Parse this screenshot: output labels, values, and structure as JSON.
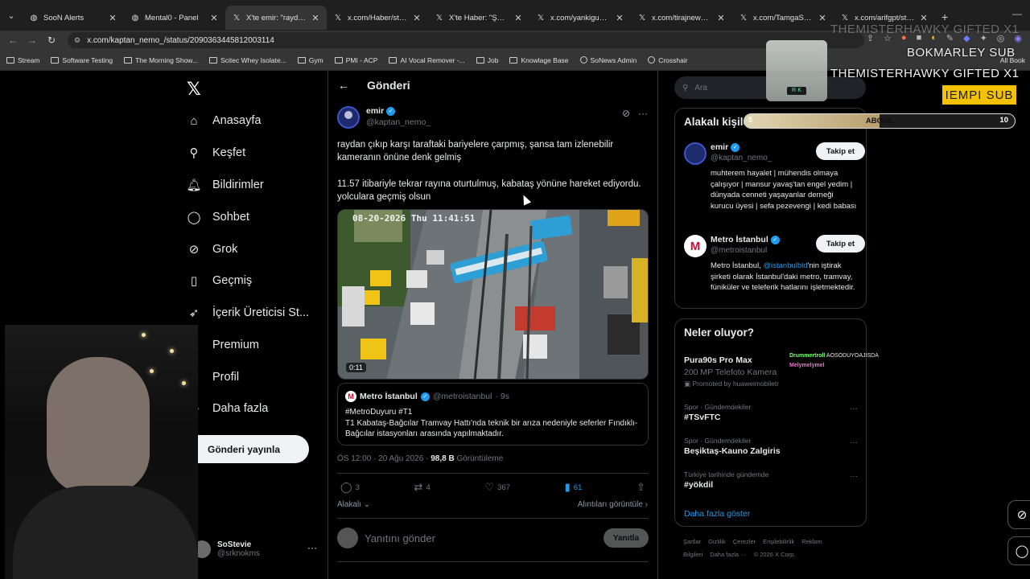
{
  "browser": {
    "tabs": [
      {
        "title": "SooN Alerts",
        "icon": "globe-icon",
        "active": false
      },
      {
        "title": "Mental0 - Panel",
        "icon": "globe-icon",
        "active": false
      },
      {
        "title": "X'te emir: \"raydan çık",
        "icon": "x-icon",
        "active": true
      },
      {
        "title": "x.com/Haber/status/...",
        "icon": "x-icon",
        "active": false
      },
      {
        "title": "X'te Haber: \"Şehirler a",
        "icon": "x-icon",
        "active": false
      },
      {
        "title": "x.com/yankigundem/...",
        "icon": "x-icon",
        "active": false
      },
      {
        "title": "x.com/tirajnews/stat...",
        "icon": "x-icon",
        "active": false
      },
      {
        "title": "x.com/TamgaSanat/st...",
        "icon": "x-icon",
        "active": false
      },
      {
        "title": "x.com/arifgpt/status/...",
        "icon": "x-icon",
        "active": false
      }
    ],
    "url": "x.com/kaptan_nemo_/status/2090363445812003114",
    "bookmarks": [
      "Stream",
      "Software Testing",
      "The Morning Show...",
      "Scitec Whey Isolate...",
      "Gym",
      "PMI - ACP",
      "AI Vocal Remover -...",
      "Job",
      "Knowlage Base",
      "SoNews Admin",
      "Crosshair"
    ],
    "all_bookmarks": "All Book"
  },
  "sidebar": {
    "items": [
      {
        "label": "Anasayfa",
        "icon": "home-icon"
      },
      {
        "label": "Keşfet",
        "icon": "search-icon"
      },
      {
        "label": "Bildirimler",
        "icon": "bell-icon"
      },
      {
        "label": "Sohbet",
        "icon": "chat-icon"
      },
      {
        "label": "Grok",
        "icon": "grok-icon"
      },
      {
        "label": "Geçmiş",
        "icon": "bookmark-icon"
      },
      {
        "label": "İçerik Üreticisi St...",
        "icon": "rocket-icon"
      },
      {
        "label": "Premium",
        "icon": "x-icon"
      },
      {
        "label": "Profil",
        "icon": "user-icon"
      },
      {
        "label": "Daha fazla",
        "icon": "more-icon"
      }
    ],
    "post_button": "Gönderi yayınla",
    "account": {
      "name": "SoStevie",
      "handle": "@srknokms"
    }
  },
  "main": {
    "title": "Gönderi",
    "author": {
      "name": "emir",
      "handle": "@kaptan_nemo_"
    },
    "text1": "raydan çıkıp karşı taraftaki bariyelere çarpmış, şansa tam izlenebilir kameranın önüne denk gelmiş",
    "text2": "11.57 itibariyle tekrar rayına oturtulmuş, kabataş yönüne hareket ediyordu. yolculara geçmiş olsun",
    "video_time": "0:11",
    "quote": {
      "name": "Metro İstanbul",
      "handle": "@metroistanbul",
      "time": "· 9s",
      "line1": "#MetroDuyuru #T1",
      "line2": "T1 Kabataş-Bağcılar Tramvay Hattı'nda teknik bir arıza nedeniyle seferler Fındıklı-Bağcılar istasyonları arasında yapılmaktadır."
    },
    "meta_time": "ÖS 12:00 · 20 Ağu 2026 · ",
    "views_value": "98,8 B",
    "views_label": " Görüntüleme",
    "actions": {
      "replies": "3",
      "reposts": "4",
      "likes": "367",
      "bookmarks": "61"
    },
    "relevant": "Alakalı",
    "quotes_link": "Alıntıları görüntüle",
    "reply_placeholder": "Yanıtını gönder",
    "reply_button": "Yanıtla"
  },
  "right": {
    "search_placeholder": "Ara",
    "related_title": "Alakalı kişile",
    "people": [
      {
        "name": "emir",
        "handle": "@kaptan_nemo_",
        "follow": "Takip et",
        "bio": "muhterem hayalet | mühendis olmaya çalışıyor | mansur yavaş'tan engel yedim | dünyada cenneti yaşayanlar derneği kurucu üyesi | sefa pezevengi | kedi babası"
      },
      {
        "name": "Metro İstanbul",
        "handle": "@metroistanbul",
        "follow": "Takip et",
        "bio_pre": "Metro İstanbul, ",
        "bio_link": "@istanbulbld",
        "bio_post": "'nin iştirak şirketi olarak İstanbul'daki metro, tramvay, füniküler ve teleferik hatlarını işletmektedir."
      }
    ],
    "trends_title": "Neler oluyor?",
    "promo": {
      "name": "Pura90s Pro Max",
      "sub": "200 MP Telefoto Kamera",
      "tag": "Promoted by huaweimobiletr"
    },
    "trends": [
      {
        "category": "Spor · Gündemdekiler",
        "name": "#TSvFTC"
      },
      {
        "category": "Spor · Gündemdekiler",
        "name": "Beşiktaş-Kauno Zalgiris"
      },
      {
        "category": "Türkiye tarihinde gündemde",
        "name": "#yökdil"
      }
    ],
    "show_more": "Daha fazla göster",
    "footer": [
      "Şartlar",
      "Gizlilik",
      "Çerezler",
      "Erişilebilirlik",
      "Reklam Bilgileri",
      "Daha fazla ···",
      "© 2026 X Corp."
    ]
  },
  "overlay": {
    "line1": "THEMISTERHAWKY  GIFTED X1",
    "line2": "BOKMARLEY  SUB",
    "line3": "THEMISTERHAWKY  GIFTED X1",
    "sub_tag": "IEMPI  SUB",
    "goal_label": "ABONE",
    "goal_min": "5",
    "goal_max": "10",
    "goal_fraction": 0.5,
    "cup_text": "R·K",
    "chat": [
      {
        "user": "Drummertroll",
        "msg": "AOSODUYOAJISDA"
      },
      {
        "user": "Melymelymel",
        "msg": ""
      }
    ]
  }
}
